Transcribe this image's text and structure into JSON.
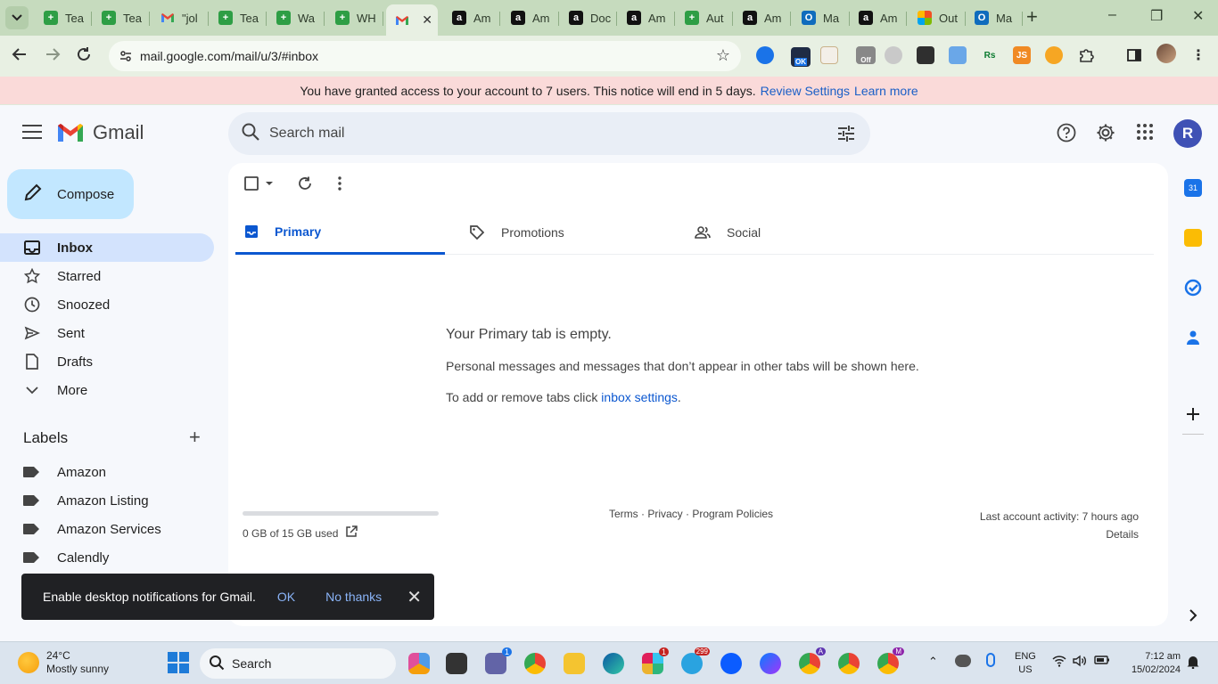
{
  "browser": {
    "tabs": [
      {
        "title": "Tea",
        "icon": "green-plus"
      },
      {
        "title": "Tea",
        "icon": "green-plus"
      },
      {
        "title": "\"jol",
        "icon": "gmail"
      },
      {
        "title": "Tea",
        "icon": "green-plus"
      },
      {
        "title": "Wa",
        "icon": "green-plus"
      },
      {
        "title": "WH",
        "icon": "green-plus"
      },
      {
        "title": "",
        "icon": "gmail",
        "active": true
      },
      {
        "title": "Am",
        "icon": "amazon"
      },
      {
        "title": "Am",
        "icon": "amazon"
      },
      {
        "title": "Doc",
        "icon": "amazon"
      },
      {
        "title": "Am",
        "icon": "amazon"
      },
      {
        "title": "Aut",
        "icon": "green-plus"
      },
      {
        "title": "Am",
        "icon": "amazon"
      },
      {
        "title": "Ma",
        "icon": "outlook"
      },
      {
        "title": "Am",
        "icon": "amazon"
      },
      {
        "title": "Out",
        "icon": "microsoft"
      },
      {
        "title": "Ma",
        "icon": "outlook"
      }
    ],
    "url": "mail.google.com/mail/u/3/#inbox",
    "ext_badge_ok": "OK",
    "ext_badge_off": "Off"
  },
  "notice": {
    "text": "You have granted access to your account to 7 users. This notice will end in 5 days.",
    "link1": "Review Settings",
    "link2": "Learn more"
  },
  "gmail": {
    "brand": "Gmail",
    "search_placeholder": "Search mail",
    "avatar_letter": "R",
    "compose": "Compose",
    "nav": [
      {
        "label": "Inbox",
        "icon": "inbox-icon",
        "active": true
      },
      {
        "label": "Starred",
        "icon": "star-icon"
      },
      {
        "label": "Snoozed",
        "icon": "clock-icon"
      },
      {
        "label": "Sent",
        "icon": "send-icon"
      },
      {
        "label": "Drafts",
        "icon": "draft-icon"
      },
      {
        "label": "More",
        "icon": "chevron-down-icon"
      }
    ],
    "labels_heading": "Labels",
    "labels": [
      "Amazon",
      "Amazon Listing",
      "Amazon Services",
      "Calendly"
    ],
    "categories": [
      {
        "label": "Primary",
        "active": true
      },
      {
        "label": "Promotions"
      },
      {
        "label": "Social"
      }
    ],
    "empty_title": "Your Primary tab is empty.",
    "empty_sub": "Personal messages and messages that don’t appear in other tabs will be shown here.",
    "empty_tip_prefix": "To add or remove tabs click ",
    "empty_tip_link": "inbox settings",
    "empty_tip_suffix": ".",
    "storage": "0 GB of 15 GB used",
    "storage_used_fraction": 0,
    "footer_links": "Terms · Privacy · Program Policies",
    "last_activity": "Last account activity: 7 hours ago",
    "details": "Details",
    "calendar_day": "31"
  },
  "toast": {
    "message": "Enable desktop notifications for Gmail.",
    "ok": "OK",
    "no_thanks": "No thanks"
  },
  "taskbar": {
    "temp": "24°C",
    "weather": "Mostly sunny",
    "search": "Search",
    "lang1": "ENG",
    "lang2": "US",
    "time": "7:12 am",
    "date": "15/02/2024",
    "badges": {
      "teams": "1",
      "slack": "1",
      "telegram": "299",
      "chrome_a": "A",
      "chrome_m": "M"
    }
  },
  "colors": {
    "tabstrip": "#c6dbbe",
    "toolbar": "#e8f0e3",
    "notice": "#fadad9",
    "compose": "#c2e7ff",
    "active_nav": "#d3e3fd",
    "accent": "#0b57d0"
  }
}
